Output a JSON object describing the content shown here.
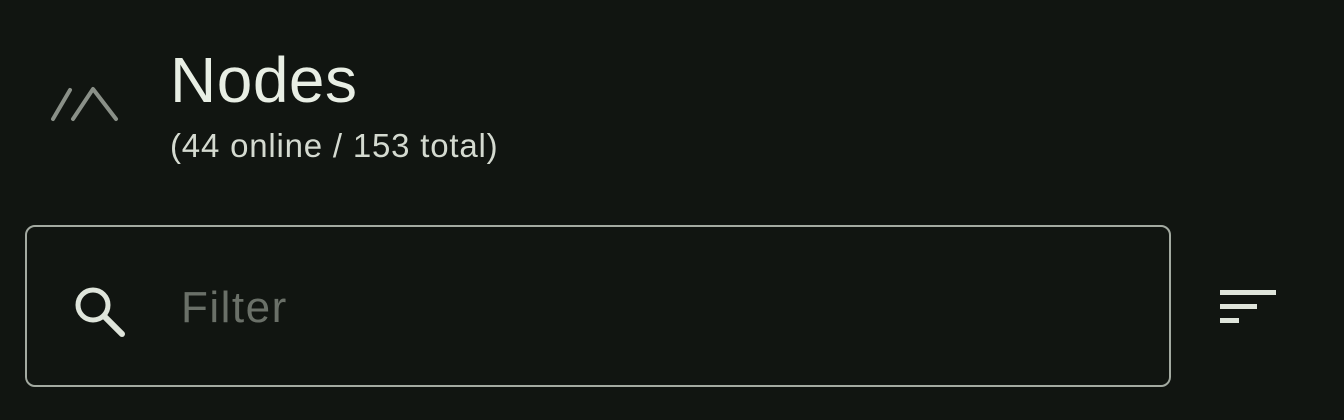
{
  "header": {
    "logo_icon": "app-logo-icon",
    "title": "Nodes",
    "subtitle": "(44 online / 153 total)"
  },
  "filter": {
    "search_icon": "search-icon",
    "placeholder": "Filter",
    "value": ""
  },
  "sort": {
    "icon": "sort-icon"
  },
  "colors": {
    "background": "#111511",
    "title_text": "#e8eee4",
    "subtitle_text": "#d4dad0",
    "border": "#a3aaa1",
    "placeholder": "#6a7068",
    "icon": "#dfe5db"
  }
}
